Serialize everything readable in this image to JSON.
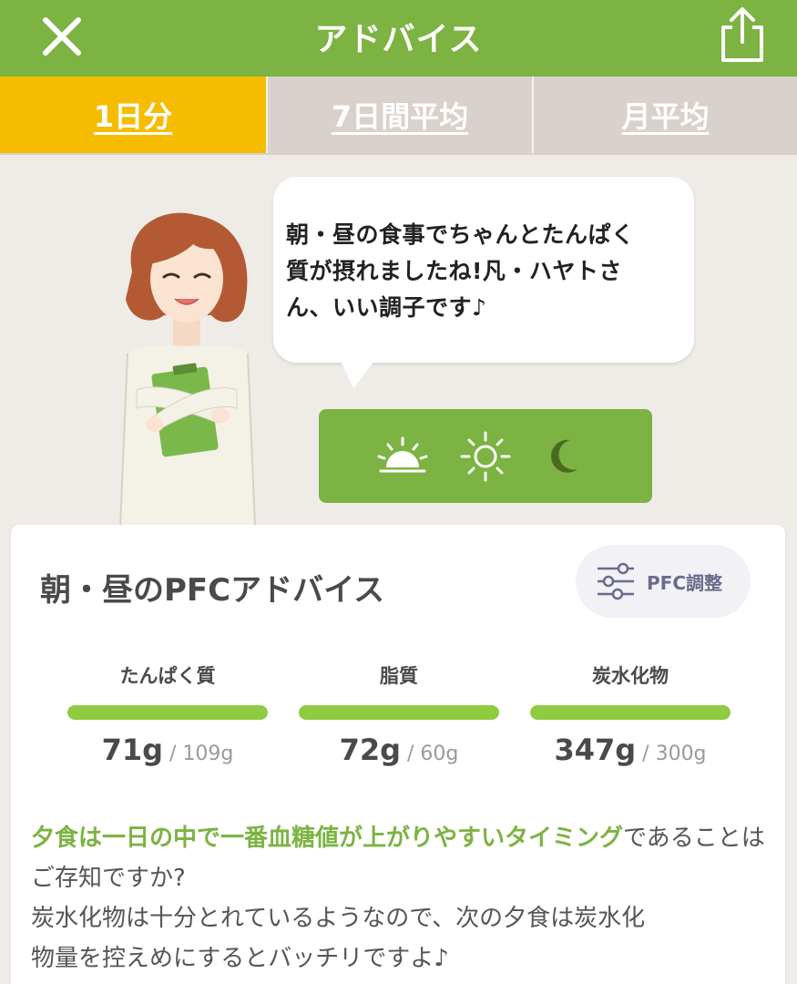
{
  "header": {
    "title": "アドバイス",
    "close_icon": "close-icon",
    "share_icon": "share-icon"
  },
  "tabs": [
    {
      "label": "1日分",
      "active": true
    },
    {
      "label": "7日間平均",
      "active": false
    },
    {
      "label": "月平均",
      "active": false
    }
  ],
  "bubble": {
    "lines": [
      "朝・昼の食事でちゃんとたんぱく",
      "質が摂れましたね!凡・ハヤトさ",
      "ん、いい調子です♪"
    ]
  },
  "meals": {
    "icons": [
      "sunrise-icon",
      "sun-icon",
      "moon-icon"
    ]
  },
  "card": {
    "title": "朝・昼のPFCアドバイス",
    "pfc_button": "PFC調整",
    "nutrients": [
      {
        "name": "たんぱく質",
        "value": "71g",
        "target": " / 109g",
        "progress": 1.0
      },
      {
        "name": "脂質",
        "value": "72g",
        "target": " / 60g",
        "progress": 1.0
      },
      {
        "name": "炭水化物",
        "value": "347g",
        "target": " / 300g",
        "progress": 1.0
      }
    ],
    "advice": {
      "highlight": "夕食は一日の中で一番血糖値が上がりやすいタイミング",
      "rest": "であることはご存知ですか?",
      "line2": "炭水化物は十分とれているようなので、次の夕食は炭水化",
      "line3": "物量を控えめにするとバッチリですよ♪"
    }
  },
  "colors": {
    "brand_green": "#7cb342",
    "tab_active": "#f6bd00",
    "tab_inactive": "#d9d1cc",
    "bar_green": "#8fcb3f"
  }
}
